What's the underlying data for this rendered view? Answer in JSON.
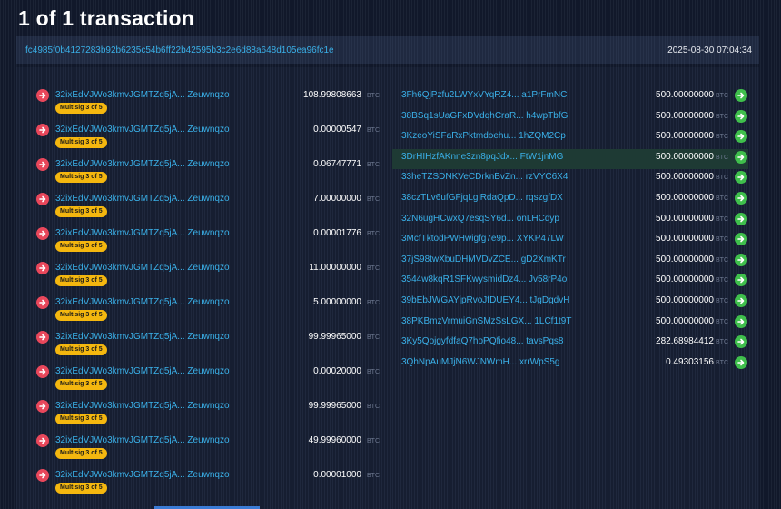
{
  "page": {
    "title": "1 of 1 transaction"
  },
  "transaction": {
    "txid": "fc4985f0b4127283b92b6235c54b6ff22b42595b3c2e6d88a648d105ea96fc1e",
    "timestamp": "2025-08-30 07:04:34"
  },
  "unit": "BTC",
  "inputs": [
    {
      "address": "32ixEdVJWo3kmvJGMTZq5jA... Zeuwnqzo",
      "badge": "Multisig 3 of 5",
      "amount": "108.99808663"
    },
    {
      "address": "32ixEdVJWo3kmvJGMTZq5jA... Zeuwnqzo",
      "badge": "Multisig 3 of 5",
      "amount": "0.00000547"
    },
    {
      "address": "32ixEdVJWo3kmvJGMTZq5jA... Zeuwnqzo",
      "badge": "Multisig 3 of 5",
      "amount": "0.06747771"
    },
    {
      "address": "32ixEdVJWo3kmvJGMTZq5jA... Zeuwnqzo",
      "badge": "Multisig 3 of 5",
      "amount": "7.00000000"
    },
    {
      "address": "32ixEdVJWo3kmvJGMTZq5jA... Zeuwnqzo",
      "badge": "Multisig 3 of 5",
      "amount": "0.00001776"
    },
    {
      "address": "32ixEdVJWo3kmvJGMTZq5jA... Zeuwnqzo",
      "badge": "Multisig 3 of 5",
      "amount": "11.00000000"
    },
    {
      "address": "32ixEdVJWo3kmvJGMTZq5jA... Zeuwnqzo",
      "badge": "Multisig 3 of 5",
      "amount": "5.00000000"
    },
    {
      "address": "32ixEdVJWo3kmvJGMTZq5jA... Zeuwnqzo",
      "badge": "Multisig 3 of 5",
      "amount": "99.99965000"
    },
    {
      "address": "32ixEdVJWo3kmvJGMTZq5jA... Zeuwnqzo",
      "badge": "Multisig 3 of 5",
      "amount": "0.00020000"
    },
    {
      "address": "32ixEdVJWo3kmvJGMTZq5jA... Zeuwnqzo",
      "badge": "Multisig 3 of 5",
      "amount": "99.99965000"
    },
    {
      "address": "32ixEdVJWo3kmvJGMTZq5jA... Zeuwnqzo",
      "badge": "Multisig 3 of 5",
      "amount": "49.99960000"
    },
    {
      "address": "32ixEdVJWo3kmvJGMTZq5jA... Zeuwnqzo",
      "badge": "Multisig 3 of 5",
      "amount": "0.00001000"
    }
  ],
  "outputs": [
    {
      "address": "3Fh6QjPzfu2LWYxVYqRZ4... a1PrFmNC",
      "amount": "500.00000000"
    },
    {
      "address": "38BSq1sUaGFxDVdqhCraR... h4wpTbfG",
      "amount": "500.00000000"
    },
    {
      "address": "3KzeoYiSFaRxPktmdoehu... 1hZQM2Cp",
      "amount": "500.00000000"
    },
    {
      "address": "3DrHIHzfAKnne3zn8pqJdx... FtW1jnMG",
      "amount": "500.00000000",
      "highlight": true
    },
    {
      "address": "33heTZSDNKVeCDrknBvZn... rzVYC6X4",
      "amount": "500.00000000"
    },
    {
      "address": "38czTLv6ufGFjqLgiRdaQpD... rqszgfDX",
      "amount": "500.00000000"
    },
    {
      "address": "32N6ugHCwxQ7esqSY6d... onLHCdyp",
      "amount": "500.00000000"
    },
    {
      "address": "3McfTktodPWHwigfg7e9p... XYKP47LW",
      "amount": "500.00000000"
    },
    {
      "address": "37jS98twXbuDHMVDvZCE... gD2XmKTr",
      "amount": "500.00000000"
    },
    {
      "address": "3544w8kqR1SFKwysmidDz4... Jv58rP4o",
      "amount": "500.00000000"
    },
    {
      "address": "39bEbJWGAYjpRvoJfDUEY4... tJgDgdvH",
      "amount": "500.00000000"
    },
    {
      "address": "38PKBmzVrmuiGnSMzSsLGX... 1LCf1t9T",
      "amount": "500.00000000"
    },
    {
      "address": "3Ky5QojgyfdfaQ7hoPQfio48... tavsPqs8",
      "amount": "282.68984412"
    },
    {
      "address": "3QhNpAuMJjN6WJNWmH... xrrWpS5g",
      "amount": "0.49303156"
    }
  ],
  "colors": {
    "link": "#3ab0e8",
    "input_arrow": "#e8475b",
    "output_arrow": "#3fbf4c",
    "badge": "#f4b70f"
  },
  "icons": {
    "input": "arrow-right-circle-red",
    "output": "arrow-right-circle-green"
  }
}
